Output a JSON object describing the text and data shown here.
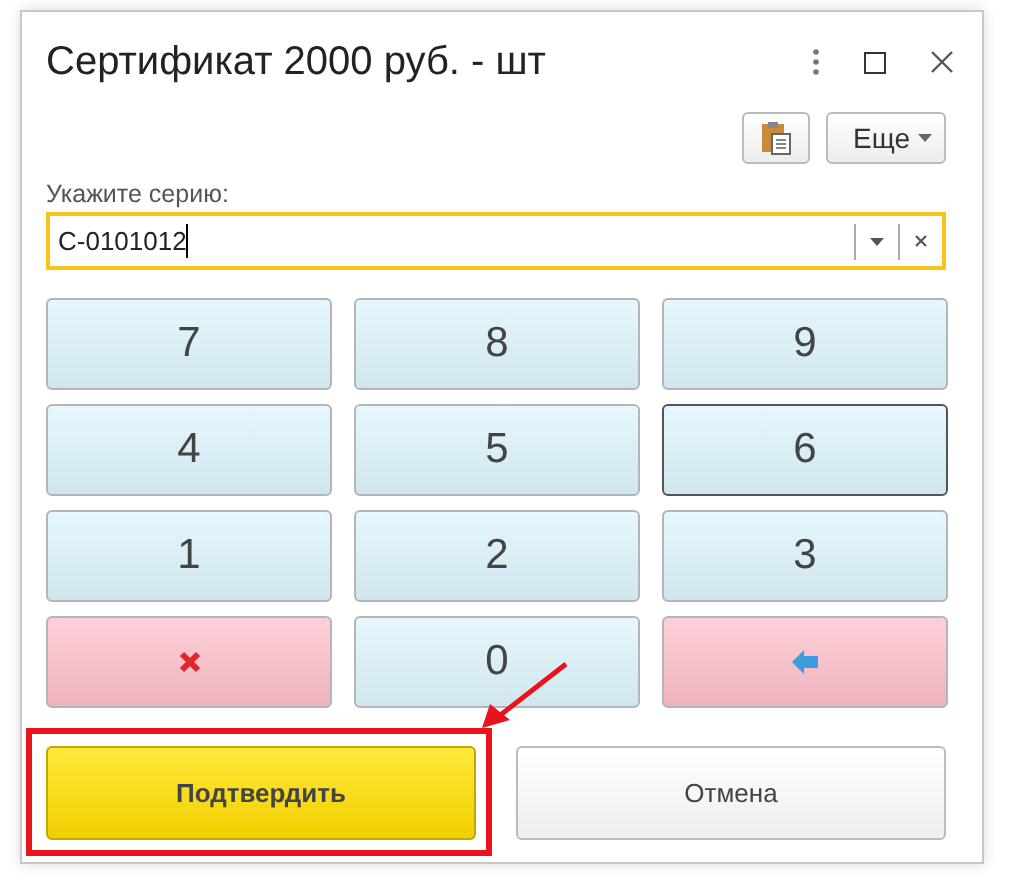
{
  "window": {
    "title": "Сертификат 2000 руб. - шт"
  },
  "toolbar": {
    "more_button": "Еще"
  },
  "series_field": {
    "label": "Укажите серию:",
    "value": "С-0101012",
    "focused": true
  },
  "keypad": [
    {
      "kind": "digit",
      "label": "7",
      "focused": false
    },
    {
      "kind": "digit",
      "label": "8",
      "focused": false
    },
    {
      "kind": "digit",
      "label": "9",
      "focused": false
    },
    {
      "kind": "digit",
      "label": "4",
      "focused": false
    },
    {
      "kind": "digit",
      "label": "5",
      "focused": false
    },
    {
      "kind": "digit",
      "label": "6",
      "focused": true
    },
    {
      "kind": "digit",
      "label": "1",
      "focused": false
    },
    {
      "kind": "digit",
      "label": "2",
      "focused": false
    },
    {
      "kind": "digit",
      "label": "3",
      "focused": false
    },
    {
      "kind": "clear",
      "focused": false
    },
    {
      "kind": "digit",
      "label": "0",
      "focused": false
    },
    {
      "kind": "backspace",
      "focused": false
    }
  ],
  "buttons": [
    {
      "label": "Подтвердить",
      "kind": "primary",
      "highlighted": true
    },
    {
      "label": "Отмена",
      "kind": "secondary",
      "highlighted": false
    }
  ]
}
